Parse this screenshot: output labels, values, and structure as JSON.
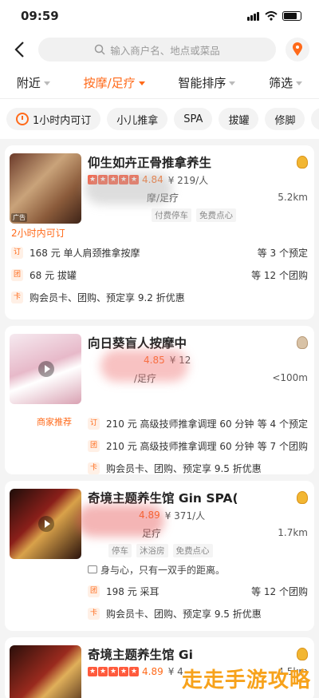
{
  "status": {
    "time": "09:59"
  },
  "search": {
    "placeholder": "输入商户名、地点或菜品"
  },
  "filters": [
    "附近",
    "按摩/足疗",
    "智能排序",
    "筛选"
  ],
  "chips": [
    "1小时内可订",
    "小儿推拿",
    "SPA",
    "拔罐",
    "修脚",
    "刮"
  ],
  "cards": [
    {
      "name": "仰生如卉正骨推拿养生",
      "score": "4.84",
      "price": "¥ 219/人",
      "category": "摩/足疗",
      "distance": "5.2km",
      "tags": [
        "付费停车",
        "免费点心"
      ],
      "note": "2小时内可订",
      "deals": [
        {
          "badge": "订",
          "text": "168 元 单人肩颈推拿按摩",
          "right": "等 3 个预定"
        },
        {
          "badge": "团",
          "text": "68 元 拔罐",
          "right": "等 12 个团购"
        },
        {
          "badge": "卡",
          "text": "购会员卡、团购、预定享 9.2 折优惠",
          "right": ""
        }
      ],
      "ad": "广告"
    },
    {
      "name": "向日葵盲人按摩中",
      "score": "4.85",
      "price": "¥ 12",
      "category": "/足疗",
      "distance": "<100m",
      "recommend": "商家推荐",
      "deals": [
        {
          "badge": "订",
          "text": "210 元 高级技师推拿调理 60 分钟",
          "right": "等 4 个预定"
        },
        {
          "badge": "团",
          "text": "210 元 高级技师推拿调理 60 分钟",
          "right": "等 7 个团购"
        },
        {
          "badge": "卡",
          "text": "购会员卡、团购、预定享 9.5 折优惠",
          "right": ""
        }
      ]
    },
    {
      "name": "奇境主题养生馆 Gin SPA(",
      "score": "4.89",
      "price": "¥ 371/人",
      "category": "足疗",
      "distance": "1.7km",
      "tags": [
        "停车",
        "沐浴房",
        "免费点心"
      ],
      "slogan": "身与心，只有一双手的距离。",
      "deals": [
        {
          "badge": "团",
          "text": "198 元 采耳",
          "right": "等 12 个团购"
        },
        {
          "badge": "卡",
          "text": "购会员卡、团购、预定享 9.5 折优惠",
          "right": ""
        }
      ]
    },
    {
      "name": "奇境主题养生馆 Gi",
      "score": "4.89",
      "price": "¥ 4",
      "distance": "4.5km"
    }
  ],
  "watermark": "走走手游攻略",
  "colors": {
    "accent": "#ff6a1a"
  }
}
